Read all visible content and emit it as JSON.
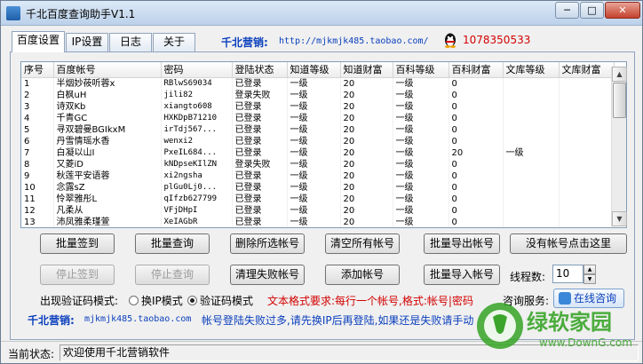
{
  "window": {
    "title": "千北百度查询助手V1.1"
  },
  "window_buttons": {
    "minimize": "─",
    "maximize": "□",
    "close": "✕"
  },
  "tabs": [
    {
      "label": "百度设置",
      "active": true
    },
    {
      "label": "IP设置",
      "active": false
    },
    {
      "label": "日志",
      "active": false
    },
    {
      "label": "关于",
      "active": false
    }
  ],
  "promo": {
    "label": "千北营销:",
    "url": "http://mjkmjk485.taobao.com/",
    "qq": "1078350533"
  },
  "table": {
    "columns": [
      "序号",
      "百度帐号",
      "密码",
      "登陆状态",
      "知道等级",
      "知道财富",
      "百科等级",
      "百科财富",
      "文库等级",
      "文库财富"
    ],
    "rows": [
      [
        "1",
        "半烟妙莜听蓉x",
        "RBlwS69034",
        "已登录",
        "一级",
        "20",
        "一级",
        "0",
        "",
        ""
      ],
      [
        "2",
        "白枫uH",
        "jili82",
        "登录失败",
        "一级",
        "20",
        "一级",
        "0",
        "",
        ""
      ],
      [
        "3",
        "诗双Kb",
        "xiangto608",
        "已登录",
        "一级",
        "20",
        "一级",
        "0",
        "",
        ""
      ],
      [
        "4",
        "千青GC",
        "HXKDpB71210",
        "已登录",
        "一级",
        "20",
        "一级",
        "0",
        "",
        ""
      ],
      [
        "5",
        "寻双碧曼BGIkxM",
        "irTdj567...",
        "已登录",
        "一级",
        "20",
        "一级",
        "0",
        "",
        ""
      ],
      [
        "6",
        "丹雪情瑶水香",
        "wenxi2",
        "已登录",
        "一级",
        "20",
        "一级",
        "0",
        "",
        ""
      ],
      [
        "7",
        "白凝以山I",
        "PxeIL684...",
        "已登录",
        "一级",
        "20",
        "一级",
        "20",
        "一级",
        ""
      ],
      [
        "8",
        "又菱iD",
        "kNDpseKIlZN",
        "登录失败",
        "一级",
        "20",
        "一级",
        "0",
        "",
        ""
      ],
      [
        "9",
        "秋莲平安语蓉",
        "xi2ngsha",
        "已登录",
        "一级",
        "20",
        "一级",
        "0",
        "",
        ""
      ],
      [
        "10",
        "念露sZ",
        "plGu0Lj0...",
        "已登录",
        "一级",
        "20",
        "一级",
        "0",
        "",
        ""
      ],
      [
        "11",
        "怜翠雅彤L",
        "qIfzb627799",
        "已登录",
        "一级",
        "20",
        "一级",
        "0",
        "",
        ""
      ],
      [
        "12",
        "凡柔从",
        "VFjDHpI",
        "已登录",
        "一级",
        "20",
        "一级",
        "0",
        "",
        ""
      ],
      [
        "13",
        "沛凤雅柔瑾萱",
        "XeIAGbR",
        "已登录",
        "一级",
        "20",
        "一级",
        "0",
        "",
        ""
      ]
    ]
  },
  "buttons": {
    "batch_login": "批量签到",
    "batch_query": "批量查询",
    "delete_selected": "删除所选帐号",
    "clear_all": "清空所有帐号",
    "batch_export": "批量导出帐号",
    "no_account": "没有帐号点击这里",
    "stop_login": "停止签到",
    "stop_query": "停止查询",
    "clean_failed": "清理失败帐号",
    "add_account": "添加帐号",
    "batch_import": "批量导入帐号"
  },
  "threads": {
    "label": "线程数:",
    "value": "10"
  },
  "captcha_mode": {
    "label": "出现验证码模式:",
    "option_ip": "换IP模式",
    "option_code": "验证码模式",
    "selected": "验证码模式"
  },
  "format_hint": "文本格式要求:每行一个帐号,格式:帐号|密码",
  "consult": {
    "label": "咨询服务:",
    "button": "在线咨询"
  },
  "bottom_promo": {
    "label": "千北营销:",
    "url": "mjkmjk485.taobao.com",
    "notice": "帐号登陆失败过多,请先换IP后再登陆,如果还是失败请手动"
  },
  "status": {
    "label": "当前状态:",
    "text": "欢迎使用千北营销软件"
  },
  "watermark": {
    "brand": "绿软家园",
    "url": "www.DownG.com"
  },
  "colors": {
    "accent_blue": "#0a3fbd",
    "warning_red": "#d40000",
    "watermark_green": "#3aa52a"
  }
}
